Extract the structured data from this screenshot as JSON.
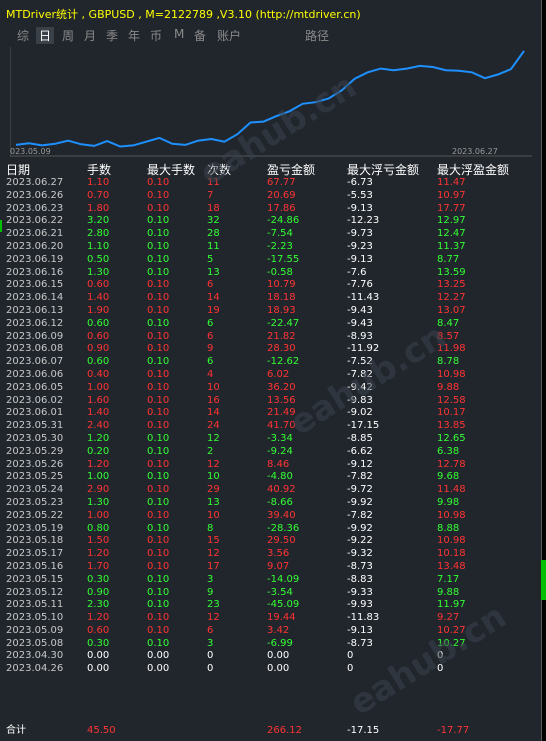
{
  "title": "MTDriver统计 , GBPUSD , M=2122789 ,V3.10 (http://mtdriver.cn)",
  "tabs": [
    {
      "label": "综",
      "active": false
    },
    {
      "label": "日",
      "active": true
    },
    {
      "label": "周",
      "active": false
    },
    {
      "label": "月",
      "active": false
    },
    {
      "label": "季",
      "active": false
    },
    {
      "label": "年",
      "active": false
    },
    {
      "label": "币",
      "active": false
    },
    {
      "label": "M",
      "active": false
    },
    {
      "label": "备",
      "active": false
    },
    {
      "label": "账户",
      "active": false
    },
    {
      "label": "路径",
      "active": false
    }
  ],
  "watermark": "eahub.cn",
  "chart_data": {
    "type": "line",
    "x_start_label": "023.05.09",
    "x_end_label": "2023.06.27",
    "color": "#1e90ff",
    "y": [
      2.0,
      3.5,
      1.5,
      3.0,
      6.0,
      2.5,
      1.0,
      5.5,
      0.5,
      1.5,
      5.0,
      8.5,
      3.0,
      2.0,
      6.0,
      7.5,
      5.0,
      12.0,
      23.0,
      23.8,
      29.0,
      33.5,
      40.5,
      42.0,
      45.5,
      53.0,
      64.0,
      70.0,
      73.5,
      72.0,
      73.5,
      76.0,
      75.0,
      72.0,
      71.5,
      70.0,
      64.5,
      68.0,
      73.0,
      90.0
    ]
  },
  "table": {
    "headers": {
      "date": "日期",
      "lots": "手数",
      "max_lots": "最大手数",
      "count": "次数",
      "pl": "盈亏金额",
      "max_float_loss": "最大浮亏金额",
      "max_float_profit": "最大浮盈金额"
    },
    "rows": [
      {
        "date": "2023.06.27",
        "lots": "1.10",
        "max_lots": "0.10",
        "count": "11",
        "pl": "67.77",
        "max_float_loss": "-6.73",
        "max_float_profit": "11.47",
        "color": "red"
      },
      {
        "date": "2023.06.26",
        "lots": "0.70",
        "max_lots": "0.10",
        "count": "7",
        "pl": "20.69",
        "max_float_loss": "-5.53",
        "max_float_profit": "10.97",
        "color": "red"
      },
      {
        "date": "2023.06.23",
        "lots": "1.80",
        "max_lots": "0.10",
        "count": "18",
        "pl": "17.86",
        "max_float_loss": "-9.13",
        "max_float_profit": "17.77",
        "color": "red"
      },
      {
        "date": "2023.06.22",
        "lots": "3.20",
        "max_lots": "0.10",
        "count": "32",
        "pl": "-24.86",
        "max_float_loss": "-12.23",
        "max_float_profit": "12.97",
        "color": "green"
      },
      {
        "date": "2023.06.21",
        "lots": "2.80",
        "max_lots": "0.10",
        "count": "28",
        "pl": "-7.54",
        "max_float_loss": "-9.73",
        "max_float_profit": "12.47",
        "color": "green"
      },
      {
        "date": "2023.06.20",
        "lots": "1.10",
        "max_lots": "0.10",
        "count": "11",
        "pl": "-2.23",
        "max_float_loss": "-9.23",
        "max_float_profit": "11.37",
        "color": "green"
      },
      {
        "date": "2023.06.19",
        "lots": "0.50",
        "max_lots": "0.10",
        "count": "5",
        "pl": "-17.55",
        "max_float_loss": "-9.13",
        "max_float_profit": "8.77",
        "color": "green"
      },
      {
        "date": "2023.06.16",
        "lots": "1.30",
        "max_lots": "0.10",
        "count": "13",
        "pl": "-0.58",
        "max_float_loss": "-7.6",
        "max_float_profit": "13.59",
        "color": "green"
      },
      {
        "date": "2023.06.15",
        "lots": "0.60",
        "max_lots": "0.10",
        "count": "6",
        "pl": "10.79",
        "max_float_loss": "-7.76",
        "max_float_profit": "13.25",
        "color": "red"
      },
      {
        "date": "2023.06.14",
        "lots": "1.40",
        "max_lots": "0.10",
        "count": "14",
        "pl": "18.18",
        "max_float_loss": "-11.43",
        "max_float_profit": "12.27",
        "color": "red"
      },
      {
        "date": "2023.06.13",
        "lots": "1.90",
        "max_lots": "0.10",
        "count": "19",
        "pl": "18.93",
        "max_float_loss": "-9.43",
        "max_float_profit": "13.07",
        "color": "red"
      },
      {
        "date": "2023.06.12",
        "lots": "0.60",
        "max_lots": "0.10",
        "count": "6",
        "pl": "-22.47",
        "max_float_loss": "-9.43",
        "max_float_profit": "8.47",
        "color": "green"
      },
      {
        "date": "2023.06.09",
        "lots": "0.60",
        "max_lots": "0.10",
        "count": "6",
        "pl": "21.82",
        "max_float_loss": "-8.93",
        "max_float_profit": "8.57",
        "color": "red"
      },
      {
        "date": "2023.06.08",
        "lots": "0.90",
        "max_lots": "0.10",
        "count": "9",
        "pl": "28.30",
        "max_float_loss": "-11.92",
        "max_float_profit": "11.98",
        "color": "red"
      },
      {
        "date": "2023.06.07",
        "lots": "0.60",
        "max_lots": "0.10",
        "count": "6",
        "pl": "-12.62",
        "max_float_loss": "-7.52",
        "max_float_profit": "8.78",
        "color": "green"
      },
      {
        "date": "2023.06.06",
        "lots": "0.40",
        "max_lots": "0.10",
        "count": "4",
        "pl": "6.02",
        "max_float_loss": "-7.82",
        "max_float_profit": "10.98",
        "color": "red"
      },
      {
        "date": "2023.06.05",
        "lots": "1.00",
        "max_lots": "0.10",
        "count": "10",
        "pl": "36.20",
        "max_float_loss": "-9.42",
        "max_float_profit": "9.88",
        "color": "red"
      },
      {
        "date": "2023.06.02",
        "lots": "1.60",
        "max_lots": "0.10",
        "count": "16",
        "pl": "13.56",
        "max_float_loss": "-9.83",
        "max_float_profit": "12.58",
        "color": "red"
      },
      {
        "date": "2023.06.01",
        "lots": "1.40",
        "max_lots": "0.10",
        "count": "14",
        "pl": "21.49",
        "max_float_loss": "-9.02",
        "max_float_profit": "10.17",
        "color": "red"
      },
      {
        "date": "2023.05.31",
        "lots": "2.40",
        "max_lots": "0.10",
        "count": "24",
        "pl": "41.70",
        "max_float_loss": "-17.15",
        "max_float_profit": "13.85",
        "color": "red"
      },
      {
        "date": "2023.05.30",
        "lots": "1.20",
        "max_lots": "0.10",
        "count": "12",
        "pl": "-3.34",
        "max_float_loss": "-8.85",
        "max_float_profit": "12.65",
        "color": "green"
      },
      {
        "date": "2023.05.29",
        "lots": "0.20",
        "max_lots": "0.10",
        "count": "2",
        "pl": "-9.24",
        "max_float_loss": "-6.62",
        "max_float_profit": "6.38",
        "color": "green"
      },
      {
        "date": "2023.05.26",
        "lots": "1.20",
        "max_lots": "0.10",
        "count": "12",
        "pl": "8.46",
        "max_float_loss": "-9.12",
        "max_float_profit": "12.78",
        "color": "red"
      },
      {
        "date": "2023.05.25",
        "lots": "1.00",
        "max_lots": "0.10",
        "count": "10",
        "pl": "-4.80",
        "max_float_loss": "-7.82",
        "max_float_profit": "9.68",
        "color": "green"
      },
      {
        "date": "2023.05.24",
        "lots": "2.90",
        "max_lots": "0.10",
        "count": "29",
        "pl": "40.92",
        "max_float_loss": "-9.72",
        "max_float_profit": "11.48",
        "color": "red"
      },
      {
        "date": "2023.05.23",
        "lots": "1.30",
        "max_lots": "0.10",
        "count": "13",
        "pl": "-8.66",
        "max_float_loss": "-9.92",
        "max_float_profit": "9.98",
        "color": "green"
      },
      {
        "date": "2023.05.22",
        "lots": "1.00",
        "max_lots": "0.10",
        "count": "10",
        "pl": "39.40",
        "max_float_loss": "-7.82",
        "max_float_profit": "10.98",
        "color": "red"
      },
      {
        "date": "2023.05.19",
        "lots": "0.80",
        "max_lots": "0.10",
        "count": "8",
        "pl": "-28.36",
        "max_float_loss": "-9.92",
        "max_float_profit": "8.88",
        "color": "green"
      },
      {
        "date": "2023.05.18",
        "lots": "1.50",
        "max_lots": "0.10",
        "count": "15",
        "pl": "29.50",
        "max_float_loss": "-9.22",
        "max_float_profit": "10.98",
        "color": "red"
      },
      {
        "date": "2023.05.17",
        "lots": "1.20",
        "max_lots": "0.10",
        "count": "12",
        "pl": "3.56",
        "max_float_loss": "-9.32",
        "max_float_profit": "10.18",
        "color": "red"
      },
      {
        "date": "2023.05.16",
        "lots": "1.70",
        "max_lots": "0.10",
        "count": "17",
        "pl": "9.07",
        "max_float_loss": "-8.73",
        "max_float_profit": "13.48",
        "color": "red"
      },
      {
        "date": "2023.05.15",
        "lots": "0.30",
        "max_lots": "0.10",
        "count": "3",
        "pl": "-14.09",
        "max_float_loss": "-8.83",
        "max_float_profit": "7.17",
        "color": "green"
      },
      {
        "date": "2023.05.12",
        "lots": "0.90",
        "max_lots": "0.10",
        "count": "9",
        "pl": "-3.54",
        "max_float_loss": "-9.33",
        "max_float_profit": "9.88",
        "color": "green"
      },
      {
        "date": "2023.05.11",
        "lots": "2.30",
        "max_lots": "0.10",
        "count": "23",
        "pl": "-45.09",
        "max_float_loss": "-9.93",
        "max_float_profit": "11.97",
        "color": "green"
      },
      {
        "date": "2023.05.10",
        "lots": "1.20",
        "max_lots": "0.10",
        "count": "12",
        "pl": "19.44",
        "max_float_loss": "-11.83",
        "max_float_profit": "9.27",
        "color": "red"
      },
      {
        "date": "2023.05.09",
        "lots": "0.60",
        "max_lots": "0.10",
        "count": "6",
        "pl": "3.42",
        "max_float_loss": "-9.13",
        "max_float_profit": "10.27",
        "color": "red"
      },
      {
        "date": "2023.05.08",
        "lots": "0.30",
        "max_lots": "0.10",
        "count": "3",
        "pl": "-6.99",
        "max_float_loss": "-8.73",
        "max_float_profit": "10.27",
        "color": "green"
      },
      {
        "date": "2023.04.30",
        "lots": "0.00",
        "max_lots": "0.00",
        "count": "0",
        "pl": "0.00",
        "max_float_loss": "0",
        "max_float_profit": "0",
        "color": "white"
      },
      {
        "date": "2023.04.26",
        "lots": "0.00",
        "max_lots": "0.00",
        "count": "0",
        "pl": "0.00",
        "max_float_loss": "0",
        "max_float_profit": "0",
        "color": "white"
      }
    ],
    "total": {
      "label": "合计",
      "lots": "45.50",
      "pl": "266.12",
      "max_float_loss": "-17.15",
      "max_float_profit": "-17.77"
    }
  }
}
